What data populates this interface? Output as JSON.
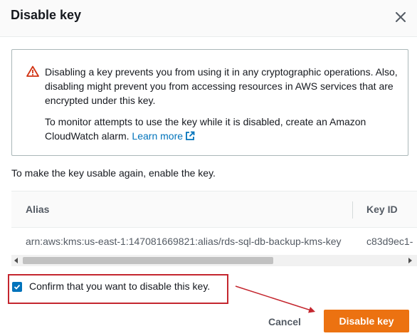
{
  "dialog": {
    "title": "Disable key"
  },
  "alert": {
    "paragraph1": "Disabling a key prevents you from using it in any cryptographic operations. Also, disabling might prevent you from accessing resources in AWS services that are encrypted under this key.",
    "paragraph2_prefix": "To monitor attempts to use the key while it is disabled, create an Amazon CloudWatch alarm. ",
    "learn_more": "Learn more",
    "icon": "warning-icon"
  },
  "info_text": "To make the key usable again, enable the key.",
  "table": {
    "columns": [
      "Alias",
      "Key ID"
    ],
    "rows": [
      {
        "alias": "arn:aws:kms:us-east-1:147081669821:alias/rds-sql-db-backup-kms-key",
        "key_id": "c83d9ec1-"
      }
    ]
  },
  "confirm": {
    "checked": true,
    "label": "Confirm that you want to disable this key."
  },
  "footer": {
    "cancel_label": "Cancel",
    "primary_label": "Disable key"
  },
  "colors": {
    "primary": "#ec7211",
    "link": "#0073bb",
    "warning": "#d13212",
    "annotation": "#c4262e"
  }
}
